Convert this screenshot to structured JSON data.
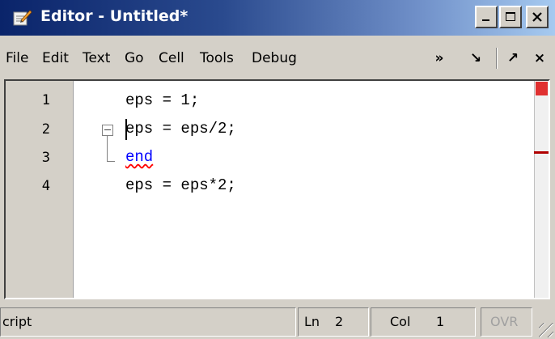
{
  "window": {
    "title": "Editor - Untitled*",
    "buttons": {
      "minimize": "_",
      "maximize": "□",
      "close": "×"
    }
  },
  "menu": {
    "items": [
      "File",
      "Edit",
      "Text",
      "Go",
      "Cell",
      "Tools",
      "Debug"
    ],
    "overflow_icon": "»",
    "dock_icon": "↘",
    "undock_icon": "↗",
    "close_icon": "×"
  },
  "editor": {
    "line_numbers": [
      "1",
      "2",
      "3",
      "4"
    ],
    "lines": [
      "eps = 1;",
      "eps = eps/2;",
      "end",
      "eps = eps*2;"
    ],
    "colors": {
      "keyword": "#0000ff",
      "warning": "#e03030"
    }
  },
  "status": {
    "mode": "cript",
    "ln_label": "Ln",
    "ln_value": "2",
    "col_label": "Col",
    "col_value": "1",
    "ovr": "OVR"
  }
}
